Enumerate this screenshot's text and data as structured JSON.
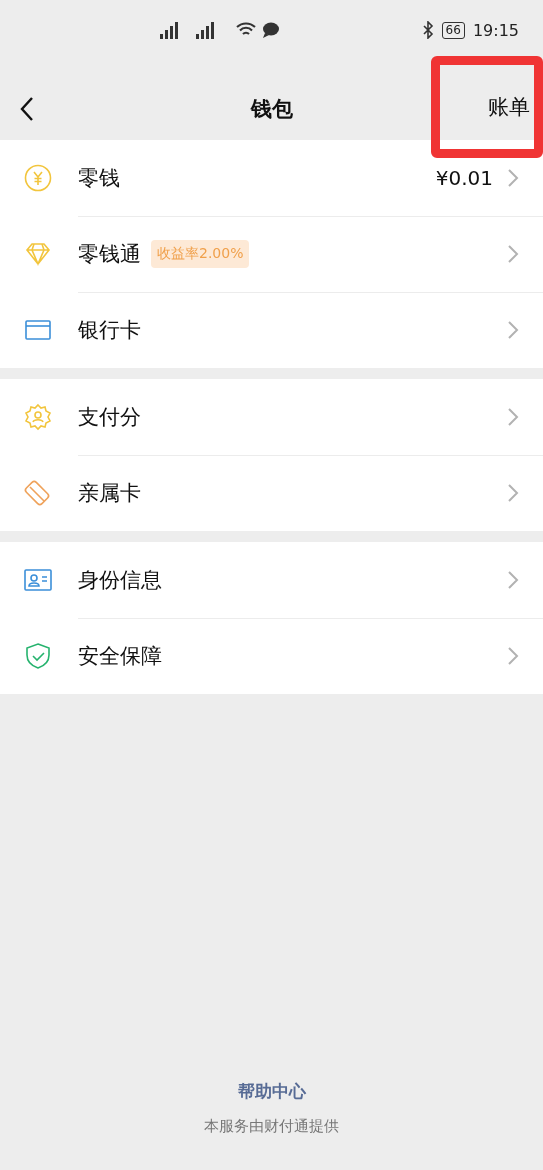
{
  "status_bar": {
    "battery": "66",
    "time": "19:15"
  },
  "nav": {
    "title": "钱包",
    "action": {
      "label": "账单",
      "highlighted": true
    }
  },
  "groups": [
    {
      "items": [
        {
          "label": "零钱",
          "value": "¥0.01"
        },
        {
          "label": "零钱通",
          "badge": "收益率2.00%"
        },
        {
          "label": "银行卡"
        }
      ]
    },
    {
      "items": [
        {
          "label": "支付分"
        },
        {
          "label": "亲属卡"
        }
      ]
    },
    {
      "items": [
        {
          "label": "身份信息"
        },
        {
          "label": "安全保障"
        }
      ]
    }
  ],
  "footer": {
    "link": "帮助中心",
    "note": "本服务由财付通提供"
  }
}
